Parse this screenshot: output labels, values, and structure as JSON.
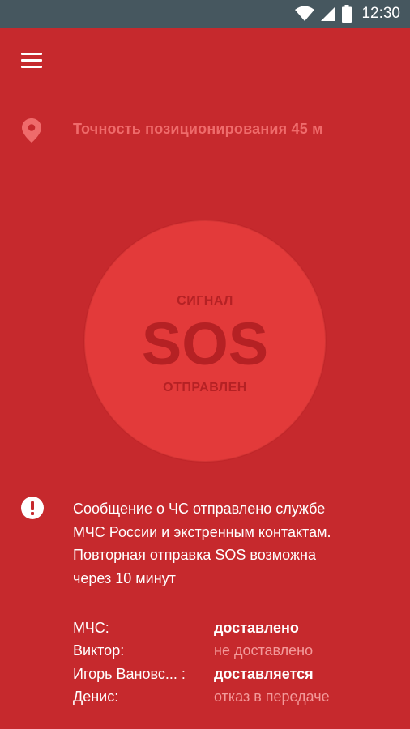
{
  "status_bar": {
    "time": "12:30",
    "icons": [
      "wifi-icon",
      "signal-icon",
      "battery-icon"
    ]
  },
  "header": {
    "menu_icon": "menu-icon"
  },
  "location": {
    "icon": "location-pin-icon",
    "accuracy_text": "Точность позиционирования 45 м"
  },
  "sos": {
    "top_label": "СИГНАЛ",
    "main_label": "SOS",
    "bottom_label": "ОТПРАВЛЕН"
  },
  "message": {
    "icon": "alert-icon",
    "lines": [
      "Сообщение о ЧС отправлено службе",
      "МЧС России и экстренным контактам.",
      "Повторная отправка SOS возможна",
      "через 10 минут"
    ]
  },
  "deliveries": [
    {
      "name": "МЧС:",
      "status": "доставлено",
      "state": "ok"
    },
    {
      "name": "Виктор:",
      "status": "не доставлено",
      "state": "fail"
    },
    {
      "name": "Игорь Вановс... :",
      "status": "доставляется",
      "state": "ok"
    },
    {
      "name": "Денис:",
      "status": "отказ в передаче",
      "state": "fail"
    }
  ],
  "colors": {
    "background": "#c6292d",
    "status_bar": "#46575f",
    "sos_circle": "#e33a3a",
    "sos_text": "#b52124",
    "accent_text": "#ef6b6b"
  }
}
